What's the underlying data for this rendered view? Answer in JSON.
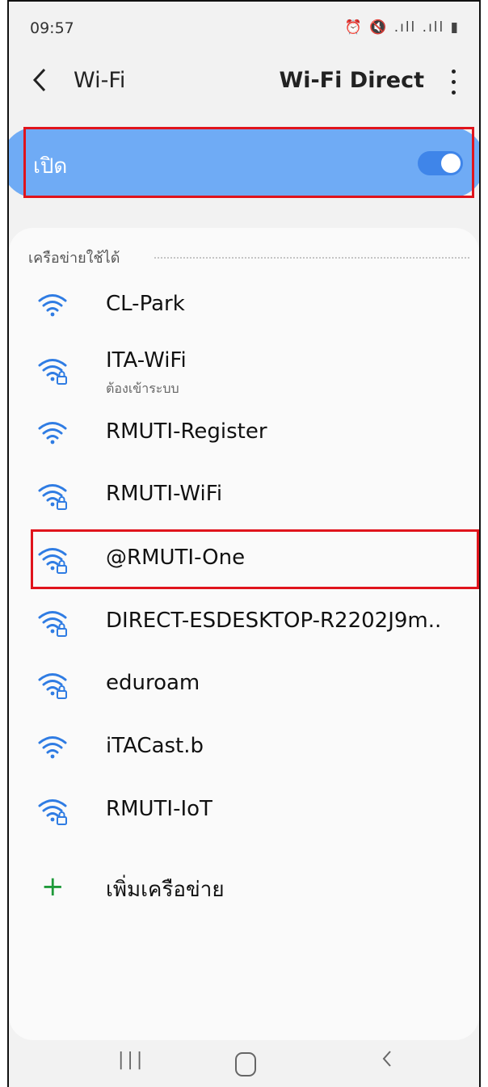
{
  "status_bar": {
    "time": "09:57",
    "icons": "⏰ 🔇 .ıll .ıll ▮"
  },
  "app_bar": {
    "title": "Wi-Fi",
    "action": "Wi-Fi Direct"
  },
  "toggle": {
    "label": "เปิด",
    "state": "on"
  },
  "networks": {
    "section_title": "เครือข่ายใช้ได้",
    "items": [
      {
        "name": "CL-Park",
        "secured": false,
        "subtitle": ""
      },
      {
        "name": "ITA-WiFi",
        "secured": true,
        "subtitle": "ต้องเข้าระบบ"
      },
      {
        "name": "RMUTI-Register",
        "secured": false,
        "subtitle": ""
      },
      {
        "name": "RMUTI-WiFi",
        "secured": true,
        "subtitle": ""
      },
      {
        "name": "@RMUTI-One",
        "secured": true,
        "subtitle": ""
      },
      {
        "name": "DIRECT-ESDESKTOP-R2202J9m..",
        "secured": true,
        "subtitle": ""
      },
      {
        "name": "eduroam",
        "secured": true,
        "subtitle": ""
      },
      {
        "name": "iTACast.b",
        "secured": false,
        "subtitle": ""
      },
      {
        "name": "RMUTI-IoT",
        "secured": true,
        "subtitle": ""
      }
    ],
    "add_label": "เพิ่มเครือข่าย"
  },
  "colors": {
    "accent": "#3f85e9",
    "toggle_bg": "#6fabf5",
    "wifi_icon": "#2f7ce3",
    "highlight": "#e0141c",
    "add": "#1f9a3a"
  }
}
